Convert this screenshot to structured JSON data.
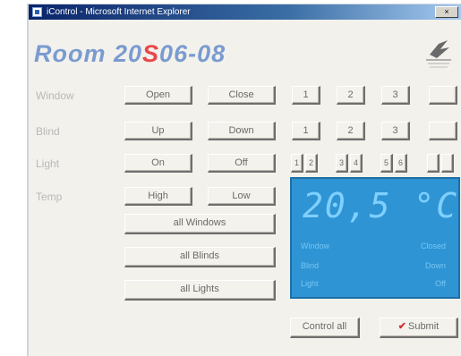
{
  "window": {
    "title": "iControl - Microsoft Internet Explorer",
    "close_label": "×"
  },
  "room": {
    "prefix": "Room 20",
    "accent": "S",
    "suffix": "06-08"
  },
  "rows": {
    "window": {
      "label": "Window",
      "open": "Open",
      "close": "Close",
      "slots": [
        "1",
        "2",
        "3",
        ""
      ]
    },
    "blind": {
      "label": "Blind",
      "up": "Up",
      "down": "Down",
      "slots": [
        "1",
        "2",
        "3",
        ""
      ]
    },
    "light": {
      "label": "Light",
      "on": "On",
      "off": "Off",
      "slots": [
        "1",
        "2",
        "3",
        "4",
        "5",
        "6",
        "",
        ""
      ]
    },
    "temp": {
      "label": "Temp",
      "high": "High",
      "low": "Low"
    }
  },
  "group_buttons": {
    "all_windows": "all Windows",
    "all_blinds": "all Blinds",
    "all_lights": "all Lights"
  },
  "display": {
    "temperature": "20,5 °C",
    "lines": [
      {
        "label": "Window",
        "value": "Closed"
      },
      {
        "label": "Blind",
        "value": "Down"
      },
      {
        "label": "Light",
        "value": "Off"
      }
    ]
  },
  "footer": {
    "control_label": "Control all",
    "submit_label": "Submit"
  },
  "colors": {
    "title_bar": "#0a246a",
    "room_title": "#7a9bd0",
    "room_accent": "#e8484a",
    "lcd_background": "#2f94d3",
    "lcd_text": "#7fd0ff"
  }
}
